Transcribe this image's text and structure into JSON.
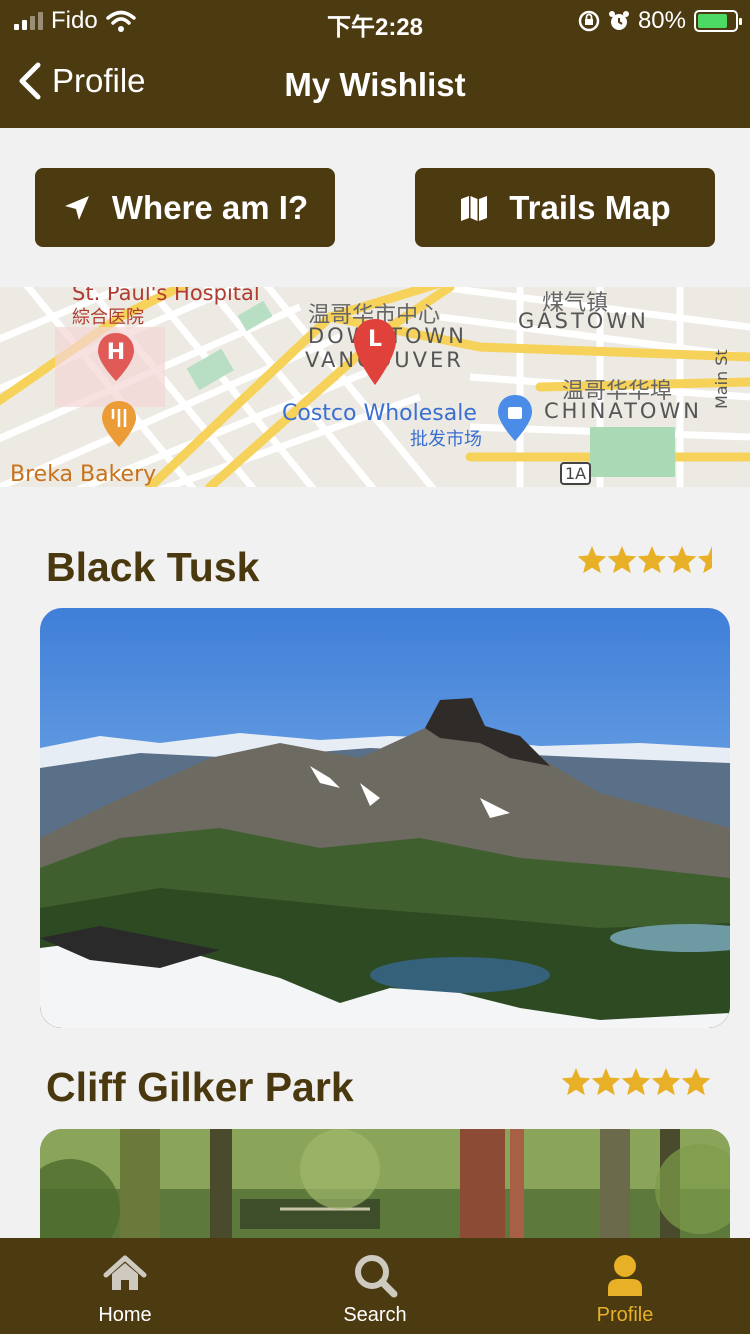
{
  "status_bar": {
    "carrier": "Fido",
    "time": "下午2:28",
    "battery_percent": "80%",
    "battery_level": 0.8,
    "signal_bars": 2
  },
  "nav": {
    "back_label": "Profile",
    "title": "My Wishlist"
  },
  "actions": {
    "where_label": "Where am I?",
    "trails_map_label": "Trails Map"
  },
  "map": {
    "labels": {
      "hospital_en": "St. Paul's Hospital",
      "hospital_zh": "綜合医院",
      "downtown_zh": "温哥华市中心",
      "downtown_en_1": "DOWNTOWN",
      "downtown_en_2": "VANCOUVER",
      "gastown_zh": "煤气镇",
      "gastown_en": "GASTOWN",
      "costco_en": "Costco Wholesale",
      "costco_zh": "批发市场",
      "chinatown_zh": "温哥华华埠",
      "chinatown_en": "CHINATOWN",
      "main_st": "Main St",
      "bakery": "Breka Bakery",
      "route": "1A",
      "marker": "L"
    }
  },
  "trails": [
    {
      "name": "Black Tusk",
      "rating": 4.5
    },
    {
      "name": "Cliff Gilker Park",
      "rating": 5
    }
  ],
  "tabs": [
    {
      "label": "Home",
      "icon": "home-icon",
      "active": false
    },
    {
      "label": "Search",
      "icon": "search-icon",
      "active": false
    },
    {
      "label": "Profile",
      "icon": "user-icon",
      "active": true
    }
  ],
  "colors": {
    "brand_brown": "#4c3a10",
    "title_brown": "#4a380e",
    "star_gold": "#e8b027",
    "background": "#f1f1f1"
  }
}
